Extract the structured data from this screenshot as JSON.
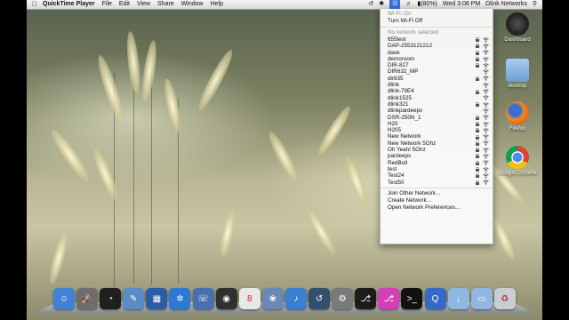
{
  "menubar": {
    "app_name": "QuickTime Player",
    "menus": [
      "File",
      "Edit",
      "View",
      "Share",
      "Window",
      "Help"
    ],
    "battery": "(80%)",
    "day_time": "Wed 3:08 PM",
    "user": "Dlink Networks"
  },
  "wifi_menu": {
    "status": "Wi-Fi: On",
    "toggle": "Turn Wi-Fi Off",
    "no_network": "No network selected",
    "networks": [
      {
        "name": "655test",
        "locked": true
      },
      {
        "name": "DAP-2553121212",
        "locked": true
      },
      {
        "name": "dave",
        "locked": true
      },
      {
        "name": "demoroom",
        "locked": true
      },
      {
        "name": "DIR-827",
        "locked": true
      },
      {
        "name": "DIR632_MP",
        "locked": false
      },
      {
        "name": "dir835",
        "locked": true
      },
      {
        "name": "dlink",
        "locked": false
      },
      {
        "name": "dlink-79E4",
        "locked": true
      },
      {
        "name": "dlink1525",
        "locked": false
      },
      {
        "name": "dlink321",
        "locked": true
      },
      {
        "name": "dlinkpardeepv",
        "locked": false
      },
      {
        "name": "DSR-250N_1",
        "locked": true
      },
      {
        "name": "H20",
        "locked": true
      },
      {
        "name": "H205",
        "locked": true
      },
      {
        "name": "New Network",
        "locked": true
      },
      {
        "name": "New Network 5Ghz",
        "locked": true
      },
      {
        "name": "Oh Yeah! 5Ghz",
        "locked": true
      },
      {
        "name": "pardeeps",
        "locked": true
      },
      {
        "name": "RedBull",
        "locked": true
      },
      {
        "name": "test",
        "locked": true
      },
      {
        "name": "Test24",
        "locked": true
      },
      {
        "name": "Test50",
        "locked": true
      }
    ],
    "join_other": "Join Other Network...",
    "create": "Create Network...",
    "open_prefs": "Open Network Preferences..."
  },
  "desktop_icons": [
    {
      "label": "Dashboard",
      "icon": "dashboard-icon",
      "color": "#2b2b2b"
    },
    {
      "label": "desktop",
      "icon": "folder-icon",
      "color": "#7fb0e0"
    },
    {
      "label": "Firefox",
      "icon": "firefox-icon",
      "color": "#e66a1a"
    },
    {
      "label": "Google Chrome",
      "icon": "chrome-icon",
      "color": "#2f8f3f"
    }
  ],
  "dock": [
    {
      "icon": "finder-icon",
      "color": "#3f82d6",
      "glyph": "☺"
    },
    {
      "icon": "launchpad-icon",
      "color": "#6e6e6e",
      "glyph": "🚀"
    },
    {
      "icon": "dashboard-icon",
      "color": "#1f1f1f",
      "glyph": "◔"
    },
    {
      "icon": "preview-icon",
      "color": "#5b8bc6",
      "glyph": "✎"
    },
    {
      "icon": "mission-control-icon",
      "color": "#2b5ca8",
      "glyph": "▦"
    },
    {
      "icon": "safari-icon",
      "color": "#2c78d6",
      "glyph": "✲"
    },
    {
      "icon": "facetime-icon",
      "color": "#4a6fae",
      "glyph": "☏"
    },
    {
      "icon": "camera-icon",
      "color": "#303030",
      "glyph": "◉"
    },
    {
      "icon": "ical-icon",
      "color": "#e8e8e8",
      "glyph": "8"
    },
    {
      "icon": "iphoto-icon",
      "color": "#6c88b5",
      "glyph": "❀"
    },
    {
      "icon": "itunes-icon",
      "color": "#3a7fd0",
      "glyph": "♪"
    },
    {
      "icon": "time-machine-icon",
      "color": "#344e6d",
      "glyph": "↺"
    },
    {
      "icon": "system-preferences-icon",
      "color": "#7a7a7a",
      "glyph": "⚙"
    },
    {
      "icon": "usb-icon",
      "color": "#1c1c1c",
      "glyph": "⎇"
    },
    {
      "icon": "usb-pink-icon",
      "color": "#d43fb8",
      "glyph": "⎇"
    },
    {
      "icon": "terminal-icon",
      "color": "#111111",
      "glyph": ">_"
    },
    {
      "icon": "quicktime-icon",
      "color": "#3469c7",
      "glyph": "Q"
    },
    {
      "icon": "downloads-folder-icon",
      "color": "#8fb7df",
      "glyph": "↓"
    },
    {
      "icon": "documents-folder-icon",
      "color": "#8fb7df",
      "glyph": "▭"
    },
    {
      "icon": "trash-icon",
      "color": "#c9ced5",
      "glyph": "♻"
    }
  ]
}
